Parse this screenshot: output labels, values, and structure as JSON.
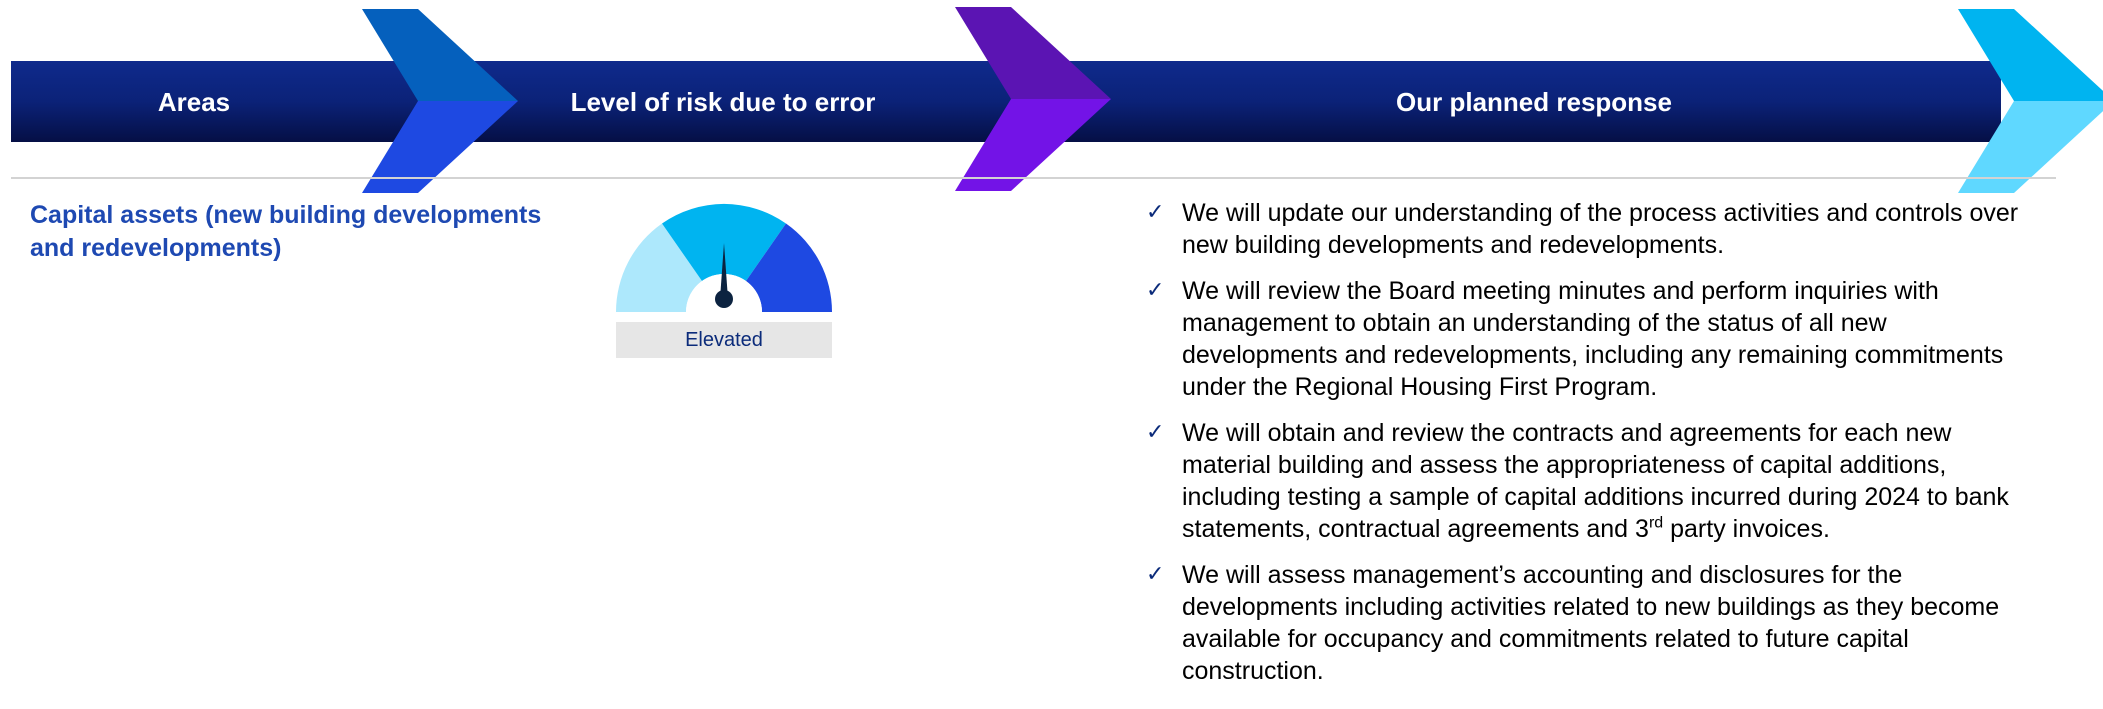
{
  "header": {
    "columns": [
      {
        "label": "Areas"
      },
      {
        "label": "Level of risk due to error"
      },
      {
        "label": "Our planned response"
      }
    ],
    "colors": {
      "bar_top": "#0f2a8c",
      "bar_bottom": "#050f45",
      "chevron_1": [
        "#0560bd",
        "#1e49e2"
      ],
      "chevron_2": [
        "#5b14b3",
        "#7313e7"
      ],
      "chevron_3": [
        "#00b4f0",
        "#5fd8ff"
      ]
    }
  },
  "area": {
    "title": "Capital assets (new building developments and redevelopments)"
  },
  "risk": {
    "level": "Elevated",
    "gauge": {
      "segment_colors": [
        "#ade8fc",
        "#00b4f0",
        "#1e49e2"
      ],
      "active_segment": "middle",
      "needle_color": "#0c2340"
    }
  },
  "responses": {
    "icon": "checkmark-icon",
    "items": [
      {
        "text": "We will update our understanding of the process activities and controls over new building developments and redevelopments."
      },
      {
        "text": "We will review the Board meeting minutes and perform inquiries with management to obtain an understanding of the status of all new developments and redevelopments, including any remaining commitments under the Regional Housing First Program."
      },
      {
        "text_before": "We will obtain and review the contracts and agreements for each new material building and assess the appropriateness of capital additions, including testing a sample of capital additions incurred during 2024 to bank statements, contractual agreements and 3",
        "sup": "rd",
        "text_after": " party invoices."
      },
      {
        "text": "We will assess management’s accounting and disclosures for the developments including activities related to new buildings as they become available for occupancy and commitments related to future capital construction."
      }
    ]
  }
}
